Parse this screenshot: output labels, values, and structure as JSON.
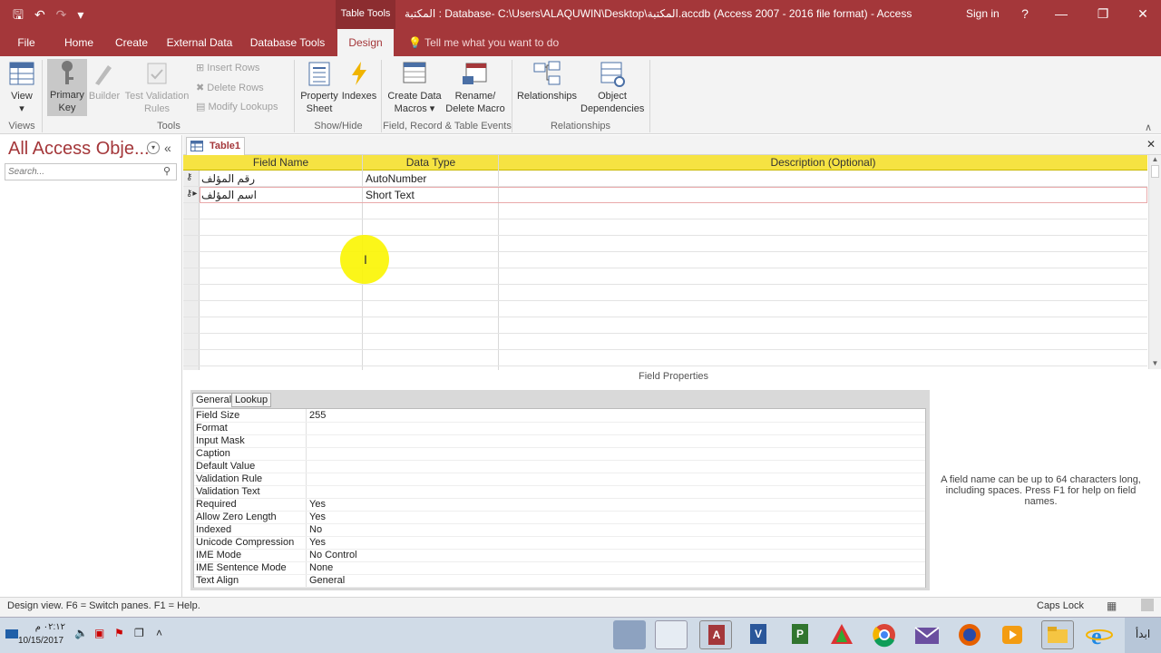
{
  "title_bar": {
    "context_group": "Table Tools",
    "title": "المكتبة : Database- C:\\Users\\ALAQUWIN\\Desktop\\المكتبة.accdb (Access 2007 - 2016 file format) - Access",
    "sign_in": "Sign in",
    "help": "?",
    "minimize": "—",
    "restore": "❐",
    "close": "✕"
  },
  "qat": {
    "save": "🖫",
    "undo": "↶",
    "redo": "↷",
    "customize": "▾"
  },
  "tabs": [
    {
      "label": "File"
    },
    {
      "label": "Home"
    },
    {
      "label": "Create"
    },
    {
      "label": "External Data"
    },
    {
      "label": "Database Tools"
    },
    {
      "label": "Design"
    }
  ],
  "tell_me": "Tell me what you want to do",
  "ribbon": {
    "view": "View",
    "primary_key": [
      "Primary",
      "Key"
    ],
    "builder": "Builder",
    "test_validation": [
      "Test Validation",
      "Rules"
    ],
    "insert_rows": "Insert Rows",
    "delete_rows": "Delete Rows",
    "modify_lookups": "Modify Lookups",
    "property_sheet": [
      "Property",
      "Sheet"
    ],
    "indexes": "Indexes",
    "create_data_macros": [
      "Create Data",
      "Macros"
    ],
    "rename_delete_macro": [
      "Rename/",
      "Delete Macro"
    ],
    "relationships": "Relationships",
    "object_dependencies": [
      "Object",
      "Dependencies"
    ],
    "groups": {
      "views": "Views",
      "tools": "Tools",
      "show_hide": "Show/Hide",
      "field_events": "Field, Record & Table Events",
      "relationships": "Relationships"
    }
  },
  "nav": {
    "title": "All Access Obje...",
    "search_placeholder": "Search...",
    "collapse": "«"
  },
  "doc": {
    "tab": "Table1",
    "close": "✕"
  },
  "grid": {
    "headers": [
      "Field Name",
      "Data Type",
      "Description (Optional)"
    ],
    "rows": [
      {
        "field": "رقم المؤلف",
        "type": "AutoNumber",
        "description": ""
      },
      {
        "field": "اسم المؤلف",
        "type": "Short Text",
        "description": ""
      }
    ]
  },
  "field_properties": {
    "title": "Field Properties",
    "tabs": [
      "General",
      "Lookup"
    ],
    "rows": [
      {
        "label": "Field Size",
        "value": "255"
      },
      {
        "label": "Format",
        "value": ""
      },
      {
        "label": "Input Mask",
        "value": ""
      },
      {
        "label": "Caption",
        "value": ""
      },
      {
        "label": "Default Value",
        "value": ""
      },
      {
        "label": "Validation Rule",
        "value": ""
      },
      {
        "label": "Validation Text",
        "value": ""
      },
      {
        "label": "Required",
        "value": "Yes"
      },
      {
        "label": "Allow Zero Length",
        "value": "Yes"
      },
      {
        "label": "Indexed",
        "value": "No"
      },
      {
        "label": "Unicode Compression",
        "value": "Yes"
      },
      {
        "label": "IME Mode",
        "value": "No Control"
      },
      {
        "label": "IME Sentence Mode",
        "value": "None"
      },
      {
        "label": "Text Align",
        "value": "General"
      }
    ],
    "help": "A field name can be up to 64 characters long, including spaces. Press F1 for help on field names."
  },
  "status": {
    "text": "Design view.  F6 = Switch panes.  F1 = Help.",
    "caps_lock": "Caps Lock"
  },
  "taskbar": {
    "time": "٠٢:١٢ م",
    "date": "10/15/2017",
    "start": "ابدأ"
  },
  "colors": {
    "accent": "#a4373a",
    "header_yellow": "#f6e342"
  }
}
